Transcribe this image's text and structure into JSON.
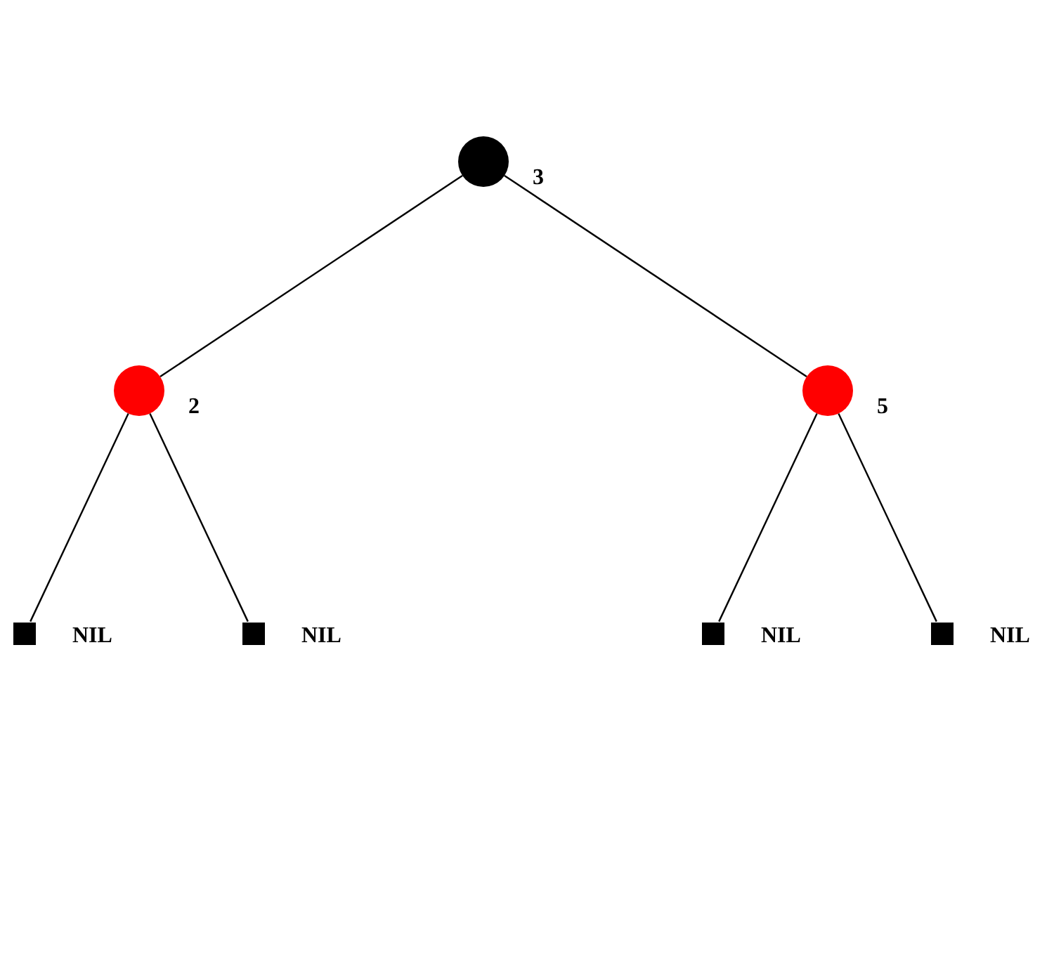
{
  "tree": {
    "kind": "node",
    "label": "3",
    "color": "#000000",
    "children": [
      {
        "kind": "node",
        "label": "2",
        "color": "#ff0000",
        "children": [
          {
            "kind": "nil",
            "label": "NIL",
            "color": "#000000"
          },
          {
            "kind": "nil",
            "label": "NIL",
            "color": "#000000"
          }
        ]
      },
      {
        "kind": "node",
        "label": "5",
        "color": "#ff0000",
        "children": [
          {
            "kind": "nil",
            "label": "NIL",
            "color": "#000000"
          },
          {
            "kind": "nil",
            "label": "NIL",
            "color": "#000000"
          }
        ]
      }
    ]
  }
}
